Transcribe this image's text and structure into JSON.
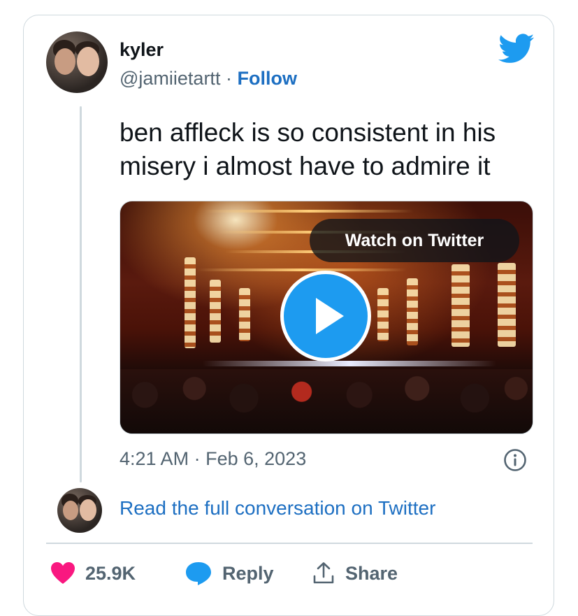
{
  "author": {
    "name": "kyler",
    "handle": "@jamiietartt",
    "separator": "·",
    "follow_label": "Follow"
  },
  "tweet": {
    "text": "ben affleck is so consistent in his misery i almost have to admire it",
    "time": "4:21 AM",
    "date": "Feb 6, 2023",
    "time_separator": "·"
  },
  "media": {
    "watch_label": "Watch on Twitter"
  },
  "conversation": {
    "link_label": "Read the full conversation on Twitter"
  },
  "actions": {
    "likes": "25.9K",
    "reply_label": "Reply",
    "share_label": "Share"
  },
  "colors": {
    "accent": "#1d9bf0",
    "link": "#1d6fc2",
    "like": "#f91880",
    "muted": "#536471",
    "border": "#cfd9de"
  },
  "icons": [
    "twitter-bird-icon",
    "play-icon",
    "info-icon",
    "heart-icon",
    "reply-bubble-icon",
    "share-icon"
  ]
}
